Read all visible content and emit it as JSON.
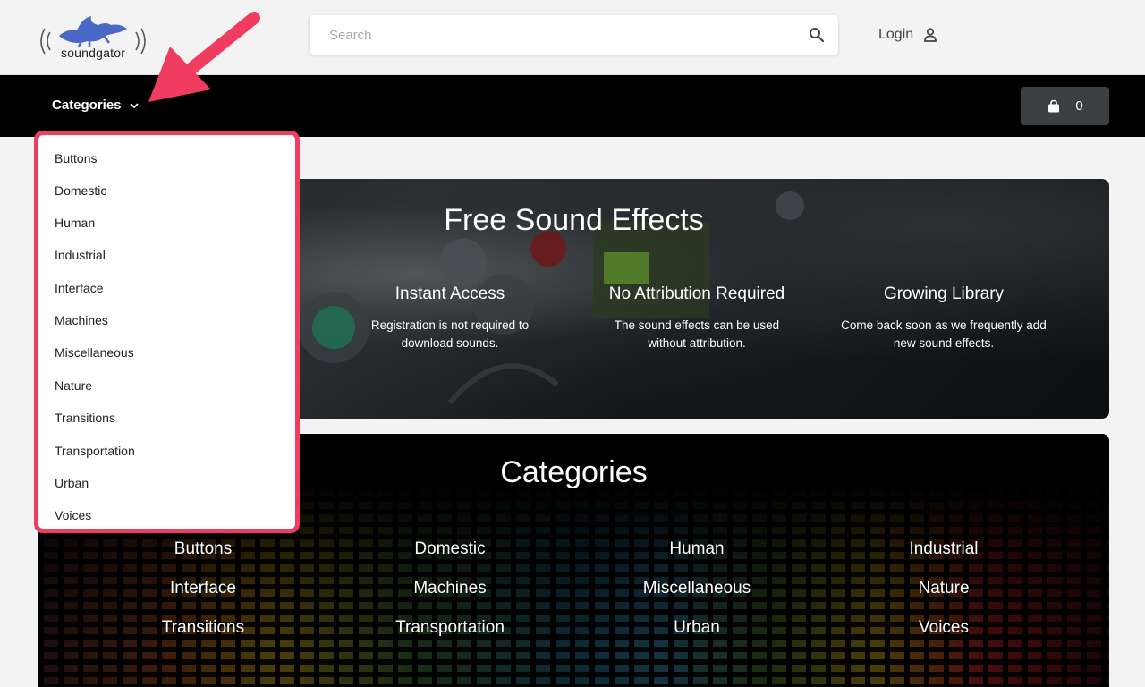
{
  "brand": {
    "name": "soundgator"
  },
  "search": {
    "placeholder": "Search",
    "value": ""
  },
  "header": {
    "login_label": "Login"
  },
  "nav": {
    "categories_label": "Categories",
    "cart_count": "0"
  },
  "hero": {
    "title": "Free Sound Effects",
    "features": [
      {
        "title": "Instant Access",
        "text_line1": "Registration is not required to",
        "text_line2": "download sounds."
      },
      {
        "title": "No Attribution Required",
        "text_line1": "The sound effects can be used",
        "text_line2": "without attribution."
      },
      {
        "title": "Growing Library",
        "text_line1": "Come back soon as we frequently add",
        "text_line2": "new sound effects."
      }
    ]
  },
  "categories_section": {
    "title": "Categories",
    "items": [
      "Buttons",
      "Domestic",
      "Human",
      "Industrial",
      "Interface",
      "Machines",
      "Miscellaneous",
      "Nature",
      "Transitions",
      "Transportation",
      "Urban",
      "Voices"
    ]
  },
  "dropdown": {
    "items": [
      "Buttons",
      "Domestic",
      "Human",
      "Industrial",
      "Interface",
      "Machines",
      "Miscellaneous",
      "Nature",
      "Transitions",
      "Transportation",
      "Urban",
      "Voices"
    ]
  },
  "colors": {
    "accent": "#f03c5f",
    "navbar": "#000000",
    "cart_button": "#3c4043"
  }
}
